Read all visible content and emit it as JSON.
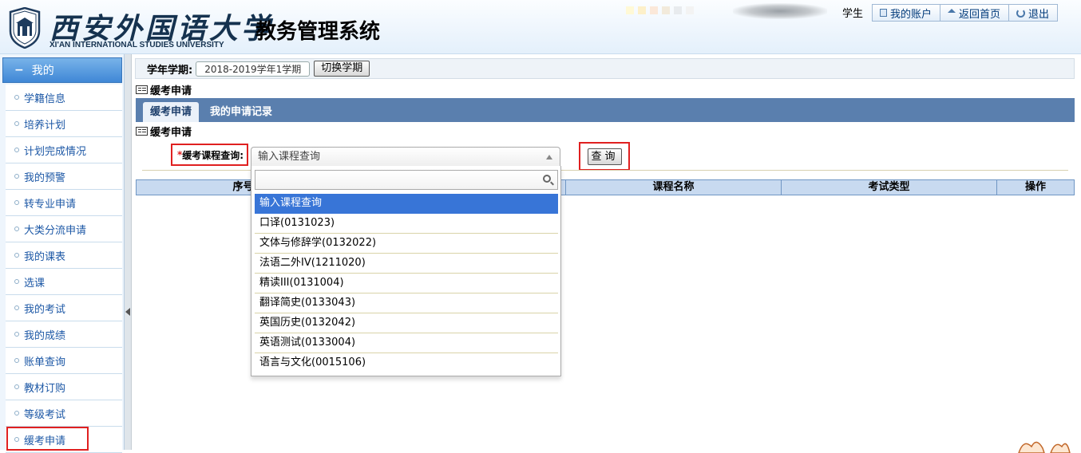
{
  "header": {
    "university_cn": "西安外国语大学",
    "university_en": "XI'AN INTERNATIONAL STUDIES UNIVERSITY",
    "system_title": "教务管理系统",
    "user_role": "学生",
    "links": [
      {
        "label": "我的账户",
        "icon": "account-doc-icon"
      },
      {
        "label": "返回首页",
        "icon": "home-icon"
      },
      {
        "label": "退出",
        "icon": "power-icon"
      }
    ],
    "swatch_colors": [
      "#fff9d6",
      "#fdf0c9",
      "#fbe8d9",
      "#f2eadb",
      "#e8ebee",
      "#f3f3f3"
    ]
  },
  "sidebar": {
    "header": "我的",
    "items": [
      "学籍信息",
      "培养计划",
      "计划完成情况",
      "我的预警",
      "转专业申请",
      "大类分流申请",
      "我的课表",
      "选课",
      "我的考试",
      "我的成绩",
      "账单查询",
      "教材订购",
      "等级考试",
      "缓考申请"
    ],
    "active_item": "缓考申请"
  },
  "term": {
    "label": "学年学期:",
    "value": "2018-2019学年1学期",
    "switch_label": "切换学期"
  },
  "page": {
    "section_title": "缓考申请",
    "tabs": [
      "缓考申请",
      "我的申请记录"
    ],
    "active_tab": "缓考申请",
    "sub_title": "缓考申请"
  },
  "query": {
    "required_mark": "*",
    "label": "缓考课程查询:",
    "select_value": "输入课程查询",
    "button_label": "查询"
  },
  "table": {
    "columns": [
      "序号",
      "",
      "课程名称",
      "考试类型",
      "操作"
    ]
  },
  "dropdown": {
    "search_value": "",
    "options": [
      "输入课程查询",
      "口译(0131023)",
      "文体与修辞学(0132022)",
      "法语二外IV(1211020)",
      "精读III(0131004)",
      "翻译简史(0133043)",
      "英国历史(0132042)",
      "英语测试(0133004)",
      "语言与文化(0015106)"
    ],
    "selected": "输入课程查询"
  },
  "colors": {
    "highlight": "#e02020",
    "tab_bar": "#5a7fae",
    "selected_option": "#3875d7",
    "sidebar_link": "#1d58a6"
  }
}
